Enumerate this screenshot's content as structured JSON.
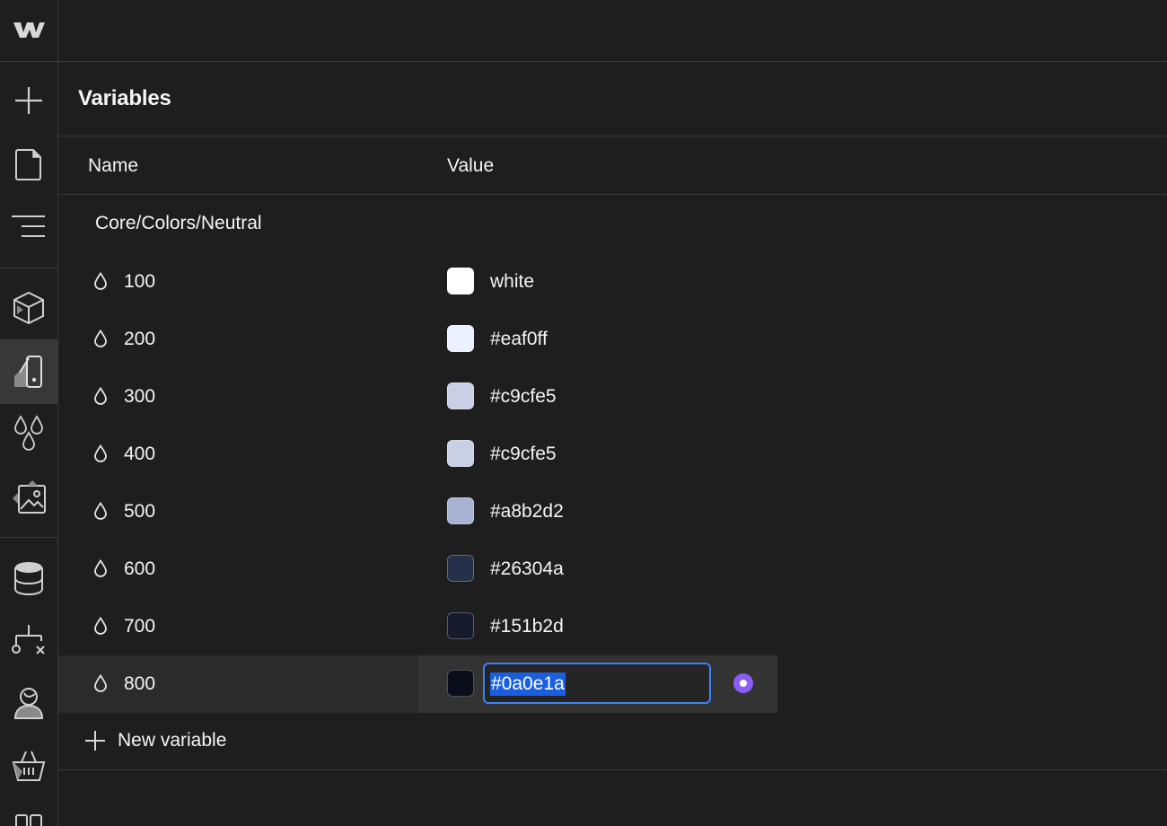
{
  "panel": {
    "title": "Variables"
  },
  "columns": {
    "name": "Name",
    "value": "Value"
  },
  "group": {
    "label": "Core/Colors/Neutral"
  },
  "rows": [
    {
      "name": "100",
      "value": "white",
      "swatch": "#ffffff"
    },
    {
      "name": "200",
      "value": "#eaf0ff",
      "swatch": "#eaf0ff"
    },
    {
      "name": "300",
      "value": "#c9cfe5",
      "swatch": "#c9cfe5"
    },
    {
      "name": "400",
      "value": "#c9cfe5",
      "swatch": "#c9cfe5"
    },
    {
      "name": "500",
      "value": "#a8b2d2",
      "swatch": "#a8b2d2"
    },
    {
      "name": "600",
      "value": "#26304a",
      "swatch": "#26304a"
    },
    {
      "name": "700",
      "value": "#151b2d",
      "swatch": "#151b2d"
    },
    {
      "name": "800",
      "value": "#0a0e1a",
      "swatch": "#0a0e1a"
    }
  ],
  "new_variable": {
    "label": "New variable"
  },
  "colors": {
    "accent_blue": "#3b82f6",
    "variable_dot": "#8b5cf6"
  },
  "sidebar": {
    "icons": [
      "webflow-logo-icon",
      "add-icon",
      "page-icon",
      "navigator-icon",
      "components-icon",
      "style-selector-icon",
      "variables-icon",
      "assets-icon",
      "cms-icon",
      "logic-icon",
      "users-icon",
      "ecommerce-icon",
      "apps-icon"
    ]
  }
}
